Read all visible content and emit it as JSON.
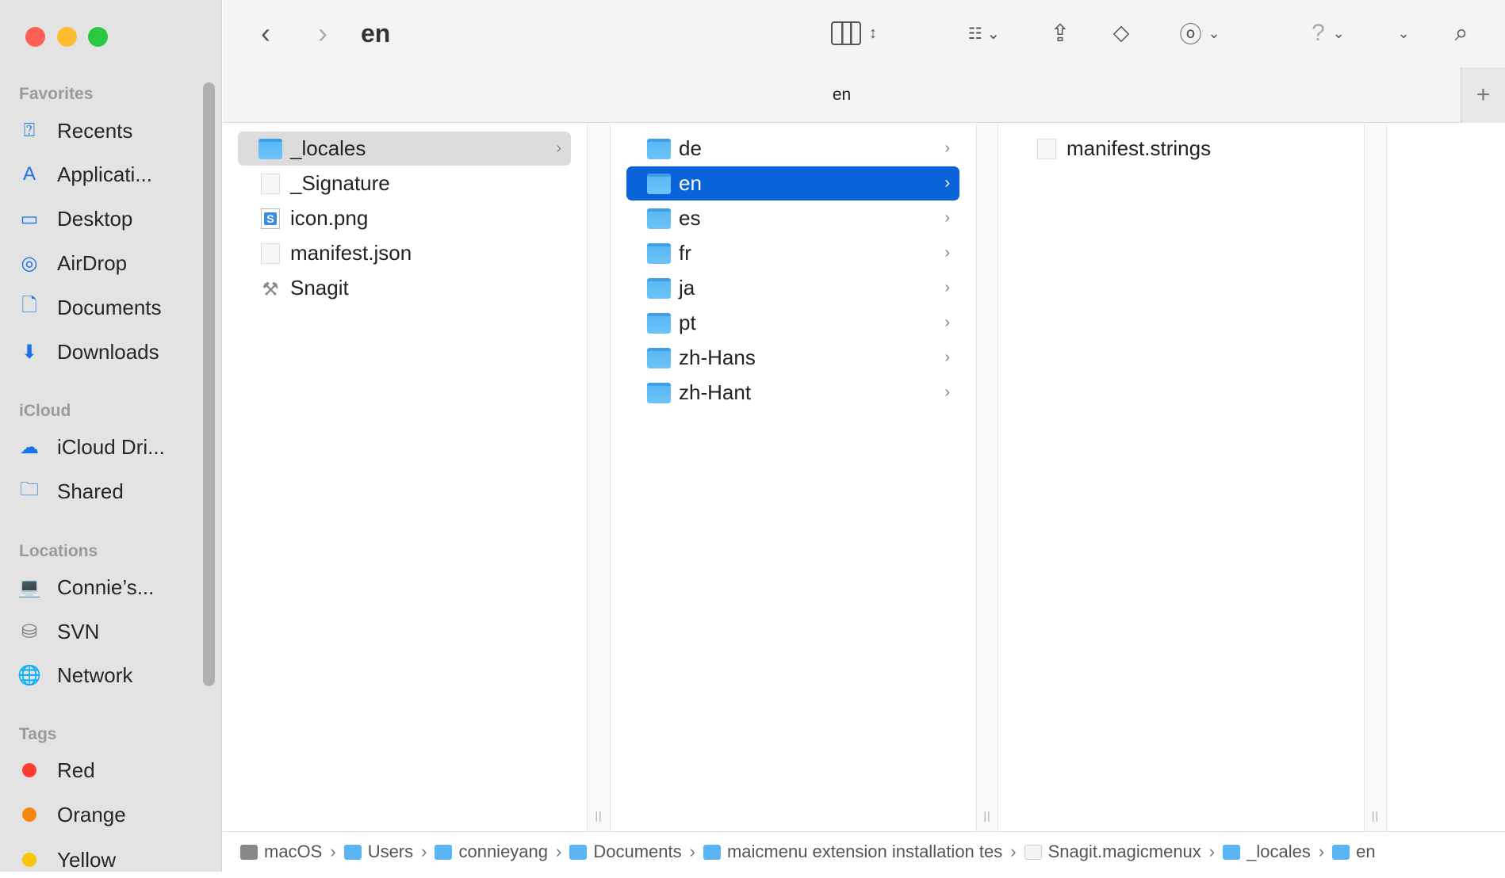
{
  "window": {
    "title": "en",
    "tab_label": "en",
    "traffic_lights": {
      "close": "#fe5f57",
      "minimize": "#febc2e",
      "zoom": "#28c840"
    }
  },
  "toolbar": {
    "icons": [
      "back-icon",
      "forward-icon",
      "column-view-icon",
      "group-icon",
      "share-icon",
      "tag-icon",
      "more-icon",
      "help-icon",
      "chevron-down-icon",
      "search-icon"
    ]
  },
  "sidebar": {
    "sections": [
      {
        "title": "Favorites",
        "items": [
          {
            "label": "Recents",
            "icon": "recents-icon"
          },
          {
            "label": "Applicati...",
            "icon": "applications-icon"
          },
          {
            "label": "Desktop",
            "icon": "desktop-icon"
          },
          {
            "label": "AirDrop",
            "icon": "airdrop-icon"
          },
          {
            "label": "Documents",
            "icon": "document-icon"
          },
          {
            "label": "Downloads",
            "icon": "downloads-icon"
          }
        ]
      },
      {
        "title": "iCloud",
        "items": [
          {
            "label": "iCloud Dri...",
            "icon": "cloud-icon"
          },
          {
            "label": "Shared",
            "icon": "shared-folder-icon"
          }
        ]
      },
      {
        "title": "Locations",
        "items": [
          {
            "label": "Connie’s...",
            "icon": "laptop-icon"
          },
          {
            "label": "SVN",
            "icon": "drive-icon"
          },
          {
            "label": "Network",
            "icon": "globe-icon"
          }
        ]
      },
      {
        "title": "Tags",
        "items": [
          {
            "label": "Red",
            "color": "#fe3b30"
          },
          {
            "label": "Orange",
            "color": "#f5880a"
          },
          {
            "label": "Yellow",
            "color": "#f6c608"
          }
        ]
      }
    ]
  },
  "columns": [
    [
      {
        "name": "_locales",
        "type": "folder",
        "selected": "inactive",
        "chevron": true
      },
      {
        "name": "_Signature",
        "type": "file"
      },
      {
        "name": "icon.png",
        "type": "image"
      },
      {
        "name": "manifest.json",
        "type": "file"
      },
      {
        "name": "Snagit",
        "type": "app"
      }
    ],
    [
      {
        "name": "de",
        "type": "folder",
        "chevron": true
      },
      {
        "name": "en",
        "type": "folder",
        "selected": "active",
        "chevron": true
      },
      {
        "name": "es",
        "type": "folder",
        "chevron": true
      },
      {
        "name": "fr",
        "type": "folder",
        "chevron": true
      },
      {
        "name": "ja",
        "type": "folder",
        "chevron": true
      },
      {
        "name": "pt",
        "type": "folder",
        "chevron": true
      },
      {
        "name": "zh-Hans",
        "type": "folder",
        "chevron": true
      },
      {
        "name": "zh-Hant",
        "type": "folder",
        "chevron": true
      }
    ],
    [
      {
        "name": "manifest.strings",
        "type": "file"
      }
    ]
  ],
  "path_bar": [
    "macOS",
    "Users",
    "connieyang",
    "Documents",
    "maicmenu extension installation tes",
    "Snagit.magicmenux",
    "_locales",
    "en"
  ]
}
